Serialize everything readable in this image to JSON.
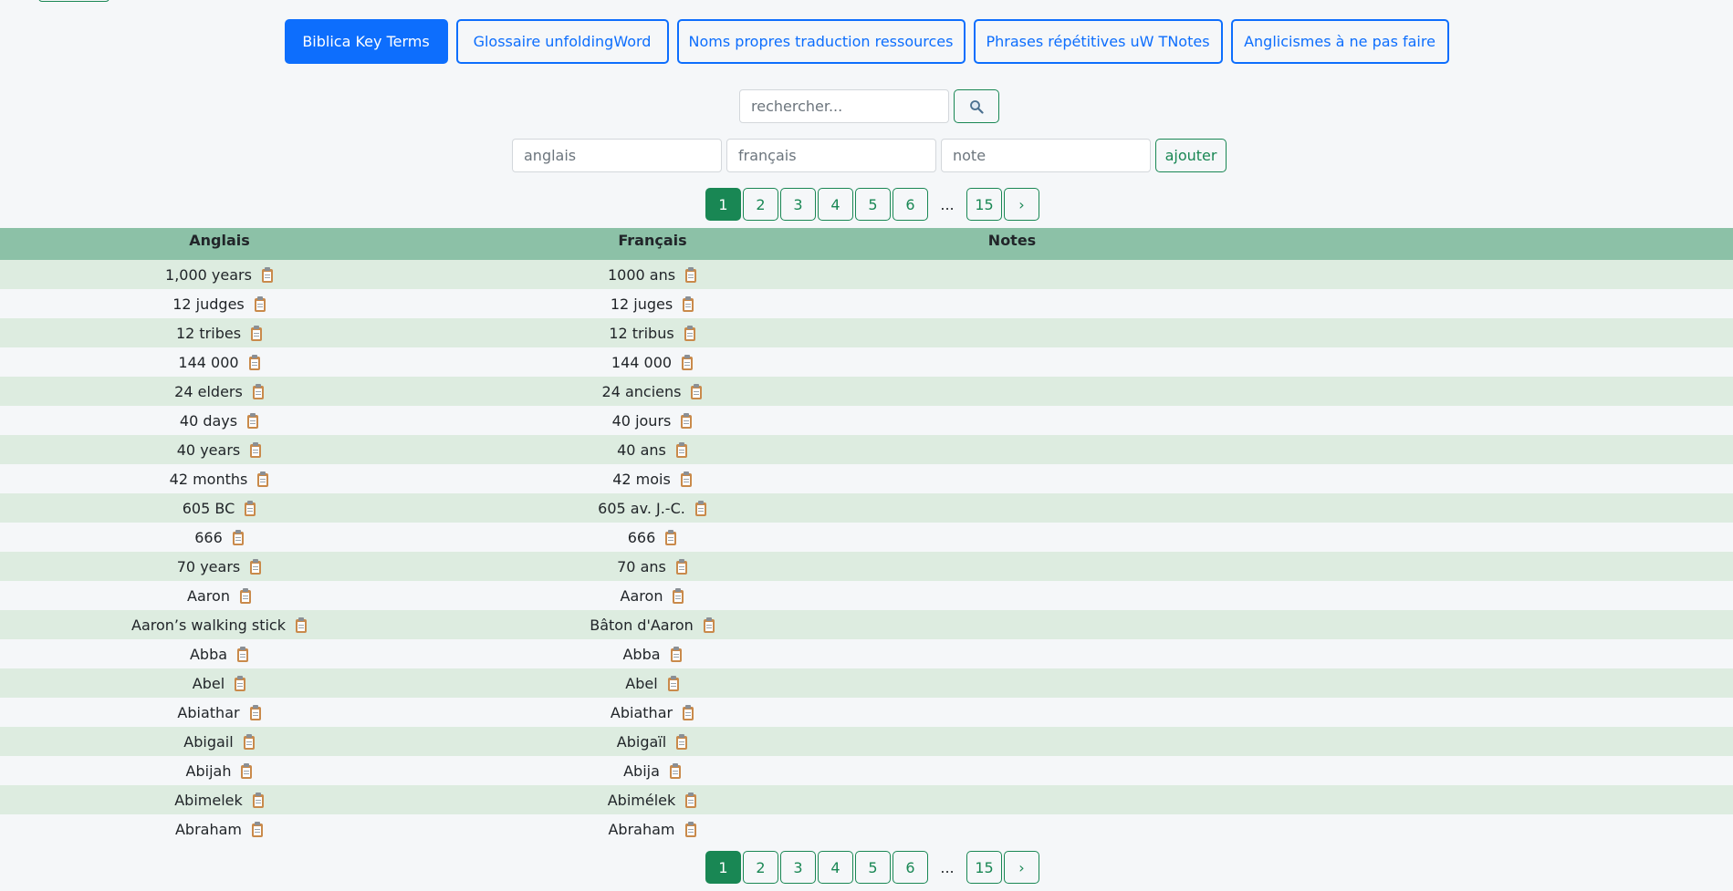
{
  "tabs": [
    {
      "label": "Biblica Key Terms",
      "active": true
    },
    {
      "label": "Glossaire unfoldingWord",
      "active": false
    },
    {
      "label": "Noms propres traduction ressources",
      "active": false
    },
    {
      "label": "Phrases répétitives uW TNotes",
      "active": false
    },
    {
      "label": "Anglicismes à ne pas faire",
      "active": false
    }
  ],
  "search": {
    "placeholder": "rechercher..."
  },
  "add_form": {
    "english_placeholder": "anglais",
    "french_placeholder": "français",
    "note_placeholder": "note",
    "add_label": "ajouter"
  },
  "pagination": {
    "pages": [
      "1",
      "2",
      "3",
      "4",
      "5",
      "6"
    ],
    "ellipsis": "...",
    "last": "15",
    "next": "›",
    "current": "1"
  },
  "table": {
    "headers": {
      "english": "Anglais",
      "french": "Français",
      "notes": "Notes"
    },
    "rows": [
      {
        "en": "1,000 years",
        "fr": "1000 ans",
        "note": ""
      },
      {
        "en": "12 judges",
        "fr": "12 juges",
        "note": ""
      },
      {
        "en": "12 tribes",
        "fr": "12 tribus",
        "note": ""
      },
      {
        "en": "144 000",
        "fr": "144 000",
        "note": ""
      },
      {
        "en": "24 elders",
        "fr": "24 anciens",
        "note": ""
      },
      {
        "en": "40 days",
        "fr": "40 jours",
        "note": ""
      },
      {
        "en": "40 years",
        "fr": "40 ans",
        "note": ""
      },
      {
        "en": "42 months",
        "fr": "42 mois",
        "note": ""
      },
      {
        "en": "605 BC",
        "fr": "605 av. J.-C.",
        "note": ""
      },
      {
        "en": "666",
        "fr": "666",
        "note": ""
      },
      {
        "en": "70 years",
        "fr": "70 ans",
        "note": ""
      },
      {
        "en": "Aaron",
        "fr": "Aaron",
        "note": ""
      },
      {
        "en": "Aaron’s walking stick",
        "fr": "Bâton d'Aaron",
        "note": ""
      },
      {
        "en": "Abba",
        "fr": "Abba",
        "note": ""
      },
      {
        "en": "Abel",
        "fr": "Abel",
        "note": ""
      },
      {
        "en": "Abiathar",
        "fr": "Abiathar",
        "note": ""
      },
      {
        "en": "Abigail",
        "fr": "Abigaïl",
        "note": ""
      },
      {
        "en": "Abijah",
        "fr": "Abija",
        "note": ""
      },
      {
        "en": "Abimelek",
        "fr": "Abimélek",
        "note": ""
      },
      {
        "en": "Abraham",
        "fr": "Abraham",
        "note": ""
      }
    ]
  },
  "colors": {
    "primary": "#0d6efd",
    "success": "#198754",
    "header_bg": "#8cc1a7",
    "row_stripe": "#ddece0"
  },
  "icons": {
    "search": "search-icon",
    "copy": "clipboard-icon"
  }
}
